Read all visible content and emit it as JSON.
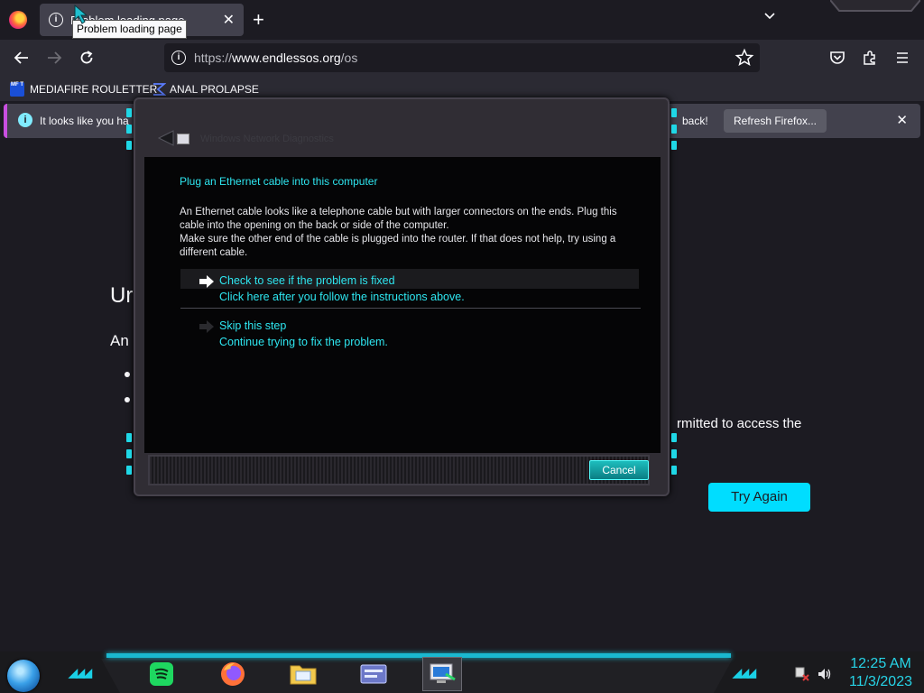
{
  "browser": {
    "tab": {
      "title": "Problem loading page"
    },
    "tooltip": "Problem loading page",
    "url": {
      "scheme": "https://",
      "host": "www.endlessos.org",
      "path": "/os"
    },
    "bookmarks": [
      {
        "label": "MEDIAFIRE ROULETTER",
        "icon_text": "MF T"
      },
      {
        "label": "ANAL PROLAPSE"
      }
    ],
    "notice": {
      "text_left": "It looks like you ha",
      "text_right": "back!",
      "button": "Refresh Firefox..."
    }
  },
  "page": {
    "heading": "Ur",
    "intro": "An",
    "permitted_text": "rmitted to access the",
    "try_again": "Try Again"
  },
  "dialog": {
    "window_title": "Windows Network Diagnostics",
    "title": "Plug an Ethernet cable into this computer",
    "body": "An Ethernet cable looks like a telephone cable but with larger connectors on the ends. Plug this cable into the opening on the back or side of the computer.",
    "body2": "Make sure the other end of the cable is plugged into the router. If that does not help, try using a different cable.",
    "option_check": {
      "label": "Check to see if the problem is fixed",
      "sub": "Click here after you follow the instructions above."
    },
    "option_skip": {
      "label": "Skip this step",
      "sub": "Continue trying to fix the problem."
    },
    "cancel": "Cancel"
  },
  "taskbar": {
    "apps": [
      "spotify-icon",
      "firefox-icon",
      "file-explorer-icon",
      "control-panel-icon",
      "network-diagnostics-icon"
    ],
    "clock": {
      "time": "12:25 AM",
      "date": "11/3/2023"
    }
  },
  "colors": {
    "accent_cyan": "#2ee6f0",
    "try_again_bg": "#00ddff",
    "notice_accent": "#c94fe0"
  }
}
